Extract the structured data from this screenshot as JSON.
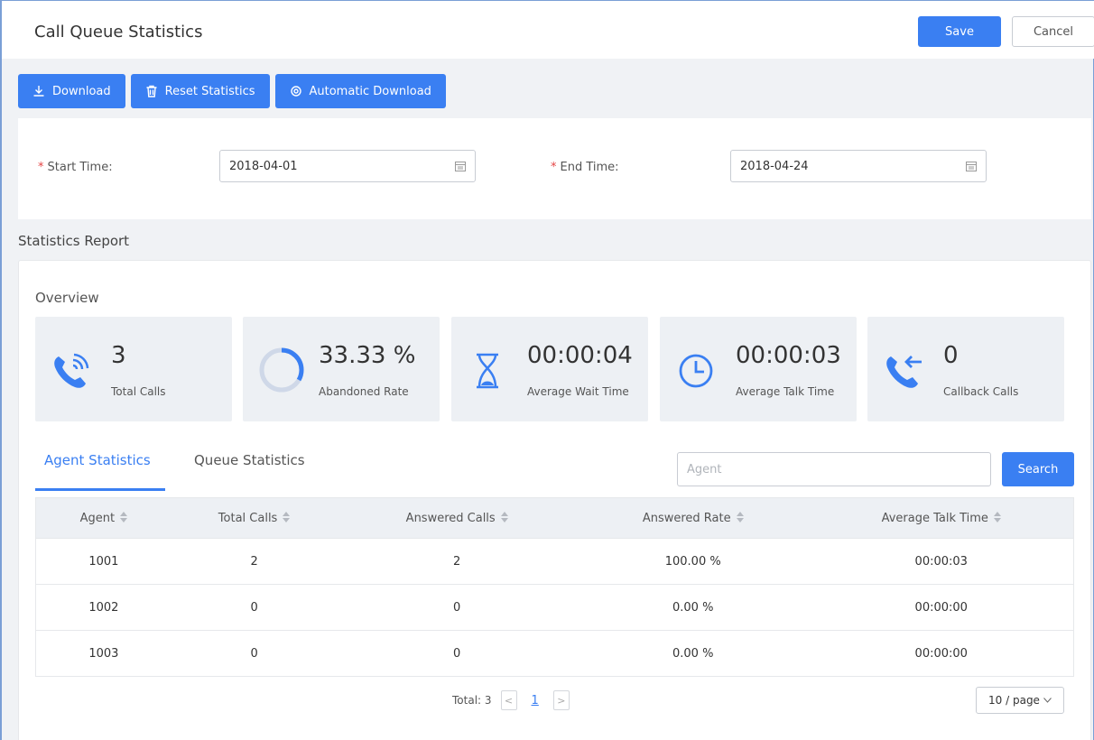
{
  "header": {
    "title": "Call Queue Statistics",
    "save_label": "Save",
    "cancel_label": "Cancel"
  },
  "toolbar": {
    "download_label": "Download",
    "reset_label": "Reset Statistics",
    "auto_download_label": "Automatic Download"
  },
  "filter": {
    "start_label": "Start Time:",
    "start_value": "2018-04-01",
    "end_label": "End Time:",
    "end_value": "2018-04-24",
    "required_mark": "*"
  },
  "report": {
    "title": "Statistics Report",
    "overview_title": "Overview",
    "cards": [
      {
        "value": "3",
        "label": "Total Calls",
        "icon": "phone-ringing-icon"
      },
      {
        "value": "33.33 %",
        "label": "Abandoned Rate",
        "icon": "progress-ring-icon"
      },
      {
        "value": "00:00:04",
        "label": "Average Wait Time",
        "icon": "hourglass-icon"
      },
      {
        "value": "00:00:03",
        "label": "Average Talk Time",
        "icon": "clock-icon"
      },
      {
        "value": "0",
        "label": "Callback Calls",
        "icon": "phone-callback-icon"
      }
    ]
  },
  "tabs": {
    "agent": "Agent Statistics",
    "queue": "Queue Statistics"
  },
  "search": {
    "placeholder": "Agent",
    "button_label": "Search"
  },
  "table": {
    "headers": [
      "Agent",
      "Total Calls",
      "Answered Calls",
      "Answered Rate",
      "Average Talk Time"
    ],
    "rows": [
      [
        "1001",
        "2",
        "2",
        "100.00 %",
        "00:00:03"
      ],
      [
        "1002",
        "0",
        "0",
        "0.00 %",
        "00:00:00"
      ],
      [
        "1003",
        "0",
        "0",
        "0.00 %",
        "00:00:00"
      ]
    ]
  },
  "pagination": {
    "total_text": "Total: 3",
    "current_page": "1",
    "prev": "<",
    "next": ">",
    "page_size": "10 / page"
  },
  "colors": {
    "accent": "#3a7ff2",
    "required": "#e54545",
    "card_bg": "#edf0f4"
  }
}
